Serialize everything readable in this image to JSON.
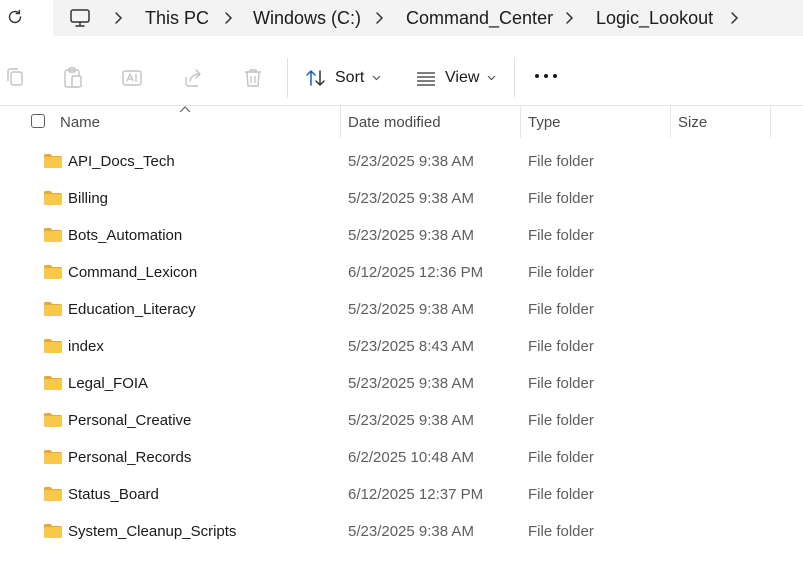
{
  "breadcrumb": {
    "items": [
      "This PC",
      "Windows (C:)",
      "Command_Center",
      "Logic_Lookout"
    ]
  },
  "toolbar": {
    "sort_label": "Sort",
    "view_label": "View"
  },
  "columns": {
    "name": "Name",
    "date": "Date modified",
    "type": "Type",
    "size": "Size"
  },
  "files": [
    {
      "name": "API_Docs_Tech",
      "date": "5/23/2025 9:38 AM",
      "type": "File folder",
      "size": ""
    },
    {
      "name": "Billing",
      "date": "5/23/2025 9:38 AM",
      "type": "File folder",
      "size": ""
    },
    {
      "name": "Bots_Automation",
      "date": "5/23/2025 9:38 AM",
      "type": "File folder",
      "size": ""
    },
    {
      "name": "Command_Lexicon",
      "date": "6/12/2025 12:36 PM",
      "type": "File folder",
      "size": ""
    },
    {
      "name": "Education_Literacy",
      "date": "5/23/2025 9:38 AM",
      "type": "File folder",
      "size": ""
    },
    {
      "name": "index",
      "date": "5/23/2025 8:43 AM",
      "type": "File folder",
      "size": ""
    },
    {
      "name": "Legal_FOIA",
      "date": "5/23/2025 9:38 AM",
      "type": "File folder",
      "size": ""
    },
    {
      "name": "Personal_Creative",
      "date": "5/23/2025 9:38 AM",
      "type": "File folder",
      "size": ""
    },
    {
      "name": "Personal_Records",
      "date": "6/2/2025 10:48 AM",
      "type": "File folder",
      "size": ""
    },
    {
      "name": "Status_Board",
      "date": "6/12/2025 12:37 PM",
      "type": "File folder",
      "size": ""
    },
    {
      "name": "System_Cleanup_Scripts",
      "date": "5/23/2025 9:38 AM",
      "type": "File folder",
      "size": ""
    }
  ],
  "icons": {
    "refresh": "refresh-icon",
    "pc": "computer-icon",
    "copy": "copy-icon",
    "paste": "paste-icon",
    "rename": "rename-icon",
    "share": "share-icon",
    "delete": "delete-icon",
    "sort": "sort-icon",
    "view": "view-icon",
    "more": "more-icon",
    "folder": "folder-icon"
  },
  "colors": {
    "folder": "#f8c84a",
    "address_bg": "#f3f3f3",
    "disabled_icon": "#c2c2c2"
  }
}
